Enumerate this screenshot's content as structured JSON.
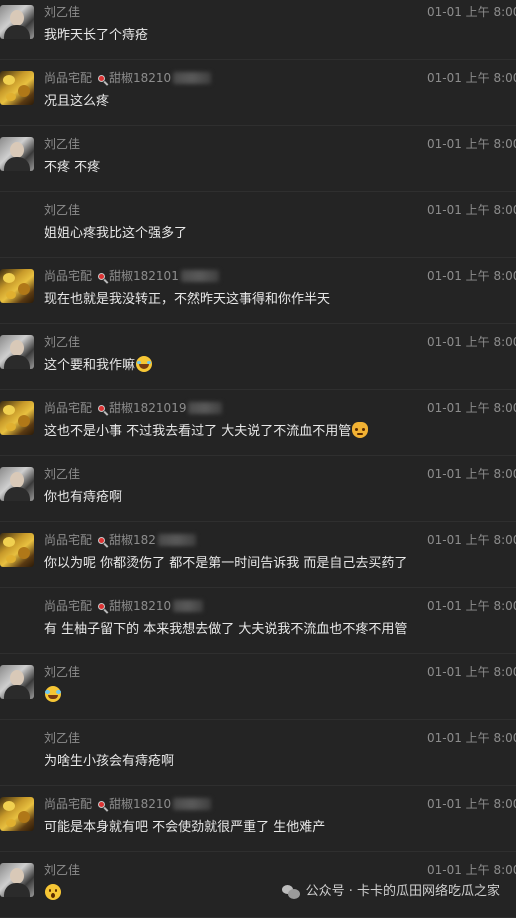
{
  "messages": [
    {
      "sender": "刘乙佳",
      "type": "liu",
      "show_avatar": true,
      "time": "01-01 上午 8:00",
      "text": "我昨天长了个痔疮",
      "emoji": ""
    },
    {
      "sender": "尚品宅配",
      "type": "shang",
      "wechat_id": "甜椒18210",
      "show_avatar": true,
      "time": "01-01 上午 8:00",
      "text": "况且这么疼",
      "emoji": ""
    },
    {
      "sender": "刘乙佳",
      "type": "liu",
      "show_avatar": true,
      "time": "01-01 上午 8:00",
      "text": "不疼 不疼",
      "emoji": ""
    },
    {
      "sender": "刘乙佳",
      "type": "liu",
      "show_avatar": false,
      "time": "01-01 上午 8:00",
      "text": "姐姐心疼我比这个强多了",
      "emoji": ""
    },
    {
      "sender": "尚品宅配",
      "type": "shang",
      "wechat_id": "甜椒182101",
      "show_avatar": true,
      "time": "01-01 上午 8:00",
      "text": "现在也就是我没转正，不然昨天这事得和你作半天",
      "emoji": ""
    },
    {
      "sender": "刘乙佳",
      "type": "liu",
      "show_avatar": true,
      "time": "01-01 上午 8:00",
      "text": "这个要和我作嘛",
      "emoji": "laugh"
    },
    {
      "sender": "尚品宅配",
      "type": "shang",
      "wechat_id": "甜椒1821019",
      "show_avatar": true,
      "time": "01-01 上午 8:00",
      "text": "这也不是小事 不过我去看过了 大夫说了不流血不用管",
      "emoji": "cat"
    },
    {
      "sender": "刘乙佳",
      "type": "liu",
      "show_avatar": true,
      "time": "01-01 上午 8:00",
      "text": "你也有痔疮啊",
      "emoji": ""
    },
    {
      "sender": "尚品宅配",
      "type": "shang",
      "wechat_id": "甜椒182",
      "show_avatar": true,
      "time": "01-01 上午 8:00",
      "text": "你以为呢 你都烫伤了 都不是第一时间告诉我 而是自己去买药了",
      "emoji": ""
    },
    {
      "sender": "尚品宅配",
      "type": "shang",
      "wechat_id": "甜椒18210",
      "show_avatar": false,
      "time": "01-01 上午 8:00",
      "text": "有 生柚子留下的 本来我想去做了 大夫说我不流血也不疼不用管",
      "emoji": ""
    },
    {
      "sender": "刘乙佳",
      "type": "liu",
      "show_avatar": true,
      "time": "01-01 上午 8:00",
      "text": "",
      "emoji": "tear"
    },
    {
      "sender": "刘乙佳",
      "type": "liu",
      "show_avatar": false,
      "time": "01-01 上午 8:00",
      "text": "为啥生小孩会有痔疮啊",
      "emoji": ""
    },
    {
      "sender": "尚品宅配",
      "type": "shang",
      "wechat_id": "甜椒18210",
      "show_avatar": true,
      "time": "01-01 上午 8:00",
      "text": "可能是本身就有吧 不会使劲就很严重了 生他难产",
      "emoji": ""
    },
    {
      "sender": "刘乙佳",
      "type": "liu",
      "show_avatar": true,
      "time": "01-01 上午 8:00",
      "text": "",
      "emoji": "wow"
    }
  ],
  "watermark": {
    "icon": "wechat-icon",
    "text": "公众号 · 卡卡的瓜田网络吃瓜之家"
  }
}
